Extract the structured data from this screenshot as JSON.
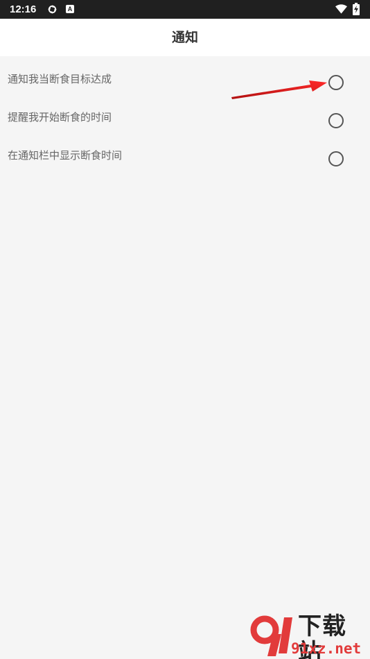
{
  "status_bar": {
    "time": "12:16",
    "notification_icon_letter": "A"
  },
  "header": {
    "title": "通知"
  },
  "settings": [
    {
      "label": "通知我当断食目标达成",
      "checked": false
    },
    {
      "label": "提醒我开始断食的时间",
      "checked": false
    },
    {
      "label": "在通知栏中显示断食时间",
      "checked": false
    }
  ],
  "watermark": {
    "text": "下载站",
    "url": "91xz.net"
  },
  "colors": {
    "status_bar_bg": "#202020",
    "page_bg": "#f5f5f5",
    "header_bg": "#ffffff",
    "arrow": "#e02020",
    "watermark_red": "#e23b3b"
  }
}
